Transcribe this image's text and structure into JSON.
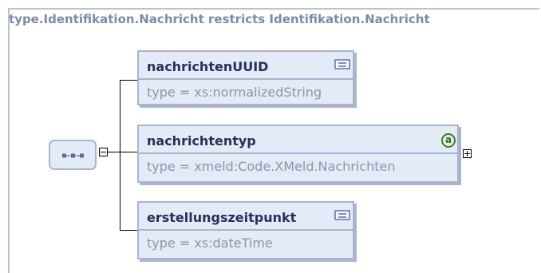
{
  "diagram": {
    "title": "type.Identifikation.Nachricht restricts Identifikation.Nachricht",
    "compositor": {
      "kind": "sequence",
      "icon": "sequence-icon",
      "toggle": "collapse"
    },
    "elements": [
      {
        "name": "nachrichtenUUID",
        "type": "type = xs:normalizedString",
        "icon": "documentation-icon",
        "has_attributes": false,
        "expandable": false
      },
      {
        "name": "nachrichtentyp",
        "type": "type = xmeld:Code.XMeld.Nachrichten",
        "icon": "attribute-icon",
        "icon_glyph": "a",
        "has_attributes": true,
        "expandable": true
      },
      {
        "name": "erstellungszeitpunkt",
        "type": "type = xs:dateTime",
        "icon": "documentation-icon",
        "has_attributes": false,
        "expandable": false
      }
    ]
  },
  "colors": {
    "title": "#7b8bac",
    "element_fill": "#e3ebf6",
    "element_border": "#a9b5cc",
    "element_name": "#2b2e5a",
    "element_type": "#8c96ad",
    "doc_icon": "#7e8fc9",
    "attr_icon": "#3c7f31"
  }
}
